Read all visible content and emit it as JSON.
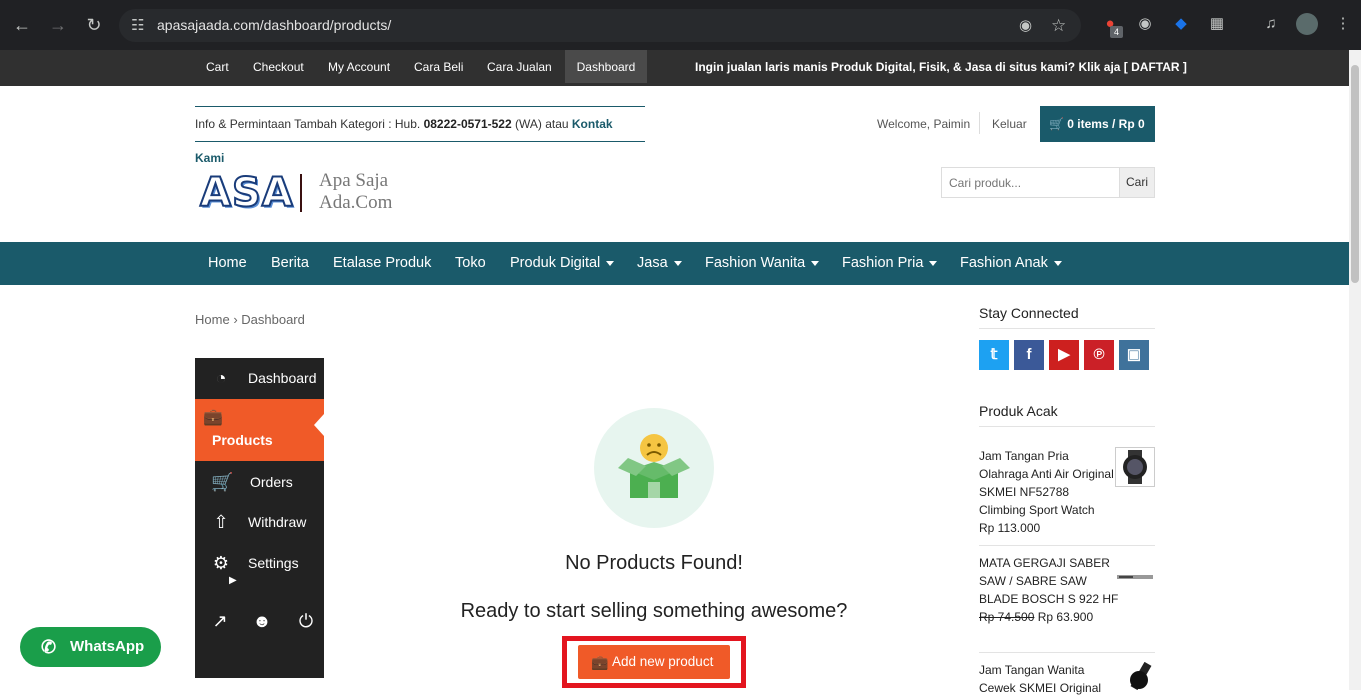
{
  "browser": {
    "url": "apasajaada.com/dashboard/products/",
    "extension_badge": "4"
  },
  "topbar": {
    "links": [
      "Cart",
      "Checkout",
      "My Account",
      "Cara Beli",
      "Cara Jualan",
      "Dashboard"
    ],
    "promo": "Ingin jualan laris manis Produk Digital, Fisik, & Jasa di situs kami? Klik aja [ DAFTAR ]"
  },
  "header": {
    "info_prefix": "Info & Permintaan Tambah Kategori : Hub. ",
    "info_phone": "08222-0571-522",
    "info_mid": " (WA) atau ",
    "info_link": "Kontak Kami",
    "welcome": "Welcome, Paimin",
    "logout": "Keluar",
    "cart": "0 items / Rp 0",
    "logo_text": "ASA",
    "logo_tagline1": "Apa Saja",
    "logo_tagline2": "Ada.Com",
    "search_placeholder": "Cari produk...",
    "search_button": "Cari"
  },
  "mainnav": [
    "Home",
    "Berita",
    "Etalase Produk",
    "Toko",
    "Produk Digital",
    "Jasa",
    "Fashion Wanita",
    "Fashion Pria",
    "Fashion Anak"
  ],
  "breadcrumb": {
    "home": "Home",
    "current": "Dashboard"
  },
  "sidebar": {
    "items": [
      "Dashboard",
      "Products",
      "Orders",
      "Withdraw",
      "Settings"
    ]
  },
  "main": {
    "empty_title": "No Products Found!",
    "empty_sub": "Ready to start selling something awesome?",
    "add_button": "Add new product"
  },
  "whatsapp": "WhatsApp",
  "right": {
    "stay_connected": "Stay Connected",
    "random_products": "Produk Acak",
    "products": [
      {
        "title": "Jam Tangan Pria Olahraga Anti Air Original SKMEI NF52788 Climbing Sport Watch",
        "price": "Rp 113.000",
        "old_price": ""
      },
      {
        "title": "MATA GERGAJI SABER SAW / SABRE SAW BLADE BOSCH S 922 HF",
        "price": "Rp 63.900",
        "old_price": "Rp 74.500"
      },
      {
        "title": "Jam Tangan Wanita Cewek SKMEI Original",
        "price": "",
        "old_price": ""
      }
    ]
  },
  "colors": {
    "teal": "#1a5a6a",
    "orange": "#f05a28",
    "dark": "#222222",
    "whatsapp": "#1a9e4a",
    "highlight": "#e3151f"
  }
}
